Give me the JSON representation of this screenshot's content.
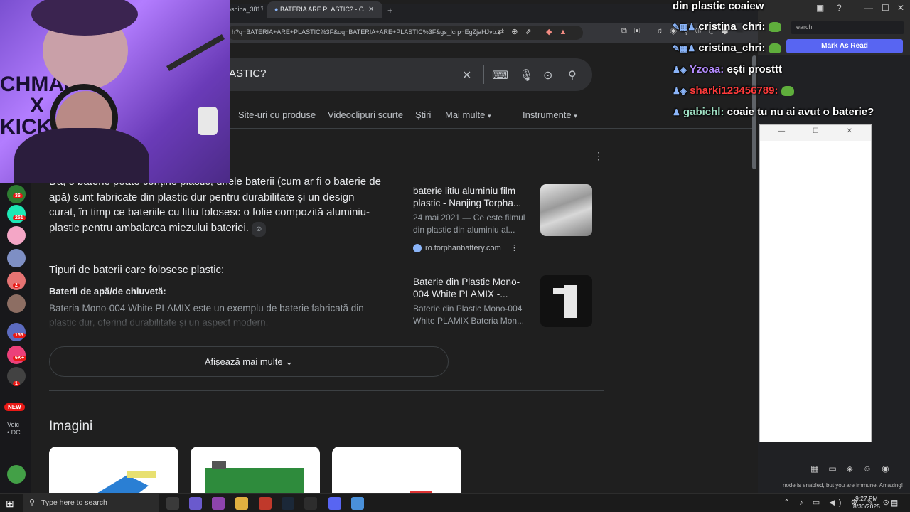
{
  "browser": {
    "tabs": [
      {
        "label": "oshiba_3817..."
      },
      {
        "label": "BATERIA ARE PLASTIC? - Căutare",
        "close": "✕"
      }
    ],
    "new_tab": "+",
    "url": "h?q=BATERIA+ARE+PLASTIC%3F&oq=BATERIA+ARE+PLASTIC%3F&gs_lcrp=EgZjaHJvb..."
  },
  "search": {
    "query": "ASTIC?"
  },
  "filters": [
    "Site-uri cu produse",
    "Videoclipuri scurte",
    "Știri",
    "Mai multe",
    "Instrumente"
  ],
  "ai_overview": {
    "paragraph": "Da, o baterie poate conține plastic; unele baterii (cum ar fi o baterie de apă) sunt fabricate din plastic dur pentru durabilitate și un design curat, în timp ce bateriile cu litiu folosesc o folie compozită aluminiu-plastic pentru ambalarea miezului bateriei.",
    "types_heading": "Tipuri de baterii care folosesc plastic:",
    "sub_heading": "Baterii de apă/de chiuvetă:",
    "sub_text": "Bateria Mono-004 White PLAMIX este un exemplu de baterie fabricată din plastic dur, oferind durabilitate și un aspect modern."
  },
  "sources": [
    {
      "title": "baterie litiu aluminiu film plastic - Nanjing Torpha...",
      "snippet": "24 mai 2021 — Ce este filmul din plastic din aluminiu al...",
      "site": "ro.torphanbattery.com"
    },
    {
      "title": "Baterie din Plastic Mono-004 White PLAMIX -...",
      "snippet": "Baterie din Plastic Mono-004 White PLAMIX Bateria Mon...",
      "site": ""
    }
  ],
  "show_more": "Afișează mai multe",
  "images_heading": "Imagini",
  "chat": [
    {
      "user": "",
      "message": "din plastic coaiew",
      "color": "#ffffff"
    },
    {
      "user": "cristina_chri:",
      "message": "",
      "color": "#ffffff"
    },
    {
      "user": "cristina_chri:",
      "message": "",
      "color": "#ffffff"
    },
    {
      "user": "Yzoaa:",
      "message": "ești prosttt",
      "color": "#b58cff"
    },
    {
      "user": "sharki123456789:",
      "message": "",
      "color": "#ff3b3b"
    },
    {
      "user": "gabichl:",
      "message": "coaie tu nu ai avut o baterie?",
      "color": "#9fe0c3"
    }
  ],
  "discord": {
    "search_placeholder": "earch",
    "mark_as_read": "Mark As Read",
    "immune_notice": "node is enabled, but you are immune. Amazing!"
  },
  "streams": {
    "badges": [
      "36",
      "251",
      "2",
      "155",
      "6K+",
      "1"
    ],
    "new_badge": "NEW",
    "voice_label": "Voic",
    "voice_sub": "• DC"
  },
  "webcam": {
    "overlay_text": "CHMAN\nX\nKICK"
  },
  "taskbar": {
    "search_placeholder": "Type here to search",
    "time": "9:27 PM",
    "date": "8/30/2025"
  },
  "colors": {
    "page_bg": "#1f1f1f",
    "accent_discord": "#5865f2",
    "badge_red": "#e91916"
  }
}
